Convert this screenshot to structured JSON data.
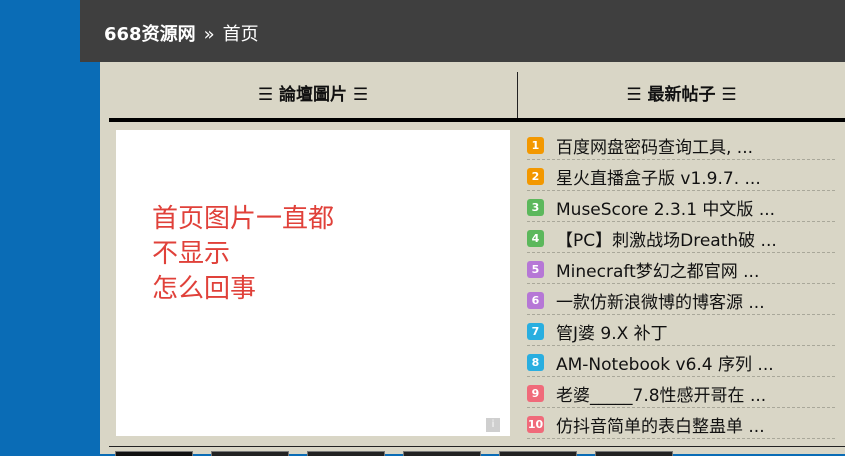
{
  "header": {
    "site_name": "668资源网",
    "separator": "»",
    "current": "首页"
  },
  "forum_images": {
    "title": "論壇圖片",
    "image_text": [
      "首页图片一直都",
      "不显示",
      "怎么回事"
    ],
    "info_label": "i"
  },
  "latest_posts": {
    "title": "最新帖子",
    "items": [
      {
        "num": "1",
        "title": "百度网盘密码查询工具, ...",
        "color": "#f39800"
      },
      {
        "num": "2",
        "title": "星火直播盒子版 v1.9.7. ...",
        "color": "#f39800"
      },
      {
        "num": "3",
        "title": "MuseScore 2.3.1 中文版 ...",
        "color": "#5cb85c"
      },
      {
        "num": "4",
        "title": "【PC】刺激战场Dreath破 ...",
        "color": "#5cb85c"
      },
      {
        "num": "5",
        "title": "Minecraft梦幻之都官网 ...",
        "color": "#b677d6"
      },
      {
        "num": "6",
        "title": "一款仿新浪微博的博客源 ...",
        "color": "#b677d6"
      },
      {
        "num": "7",
        "title": "管J婆 9.X 补丁",
        "color": "#29aee0"
      },
      {
        "num": "8",
        "title": "AM-Notebook v6.4 序列 ...",
        "color": "#29aee0"
      },
      {
        "num": "9",
        "title": "老婆_____7.8性感开哥在 ...",
        "color": "#f06a7a"
      },
      {
        "num": "10",
        "title": "仿抖音简单的表白整蛊单 ...",
        "color": "#f06a7a"
      }
    ]
  },
  "colors": {
    "sidebar": "#0a6cb6",
    "topbar": "#3f3f3f",
    "panel": "#d9d6c6",
    "image_text": "#e0413a"
  },
  "icons": {
    "column_marker": "☰"
  }
}
